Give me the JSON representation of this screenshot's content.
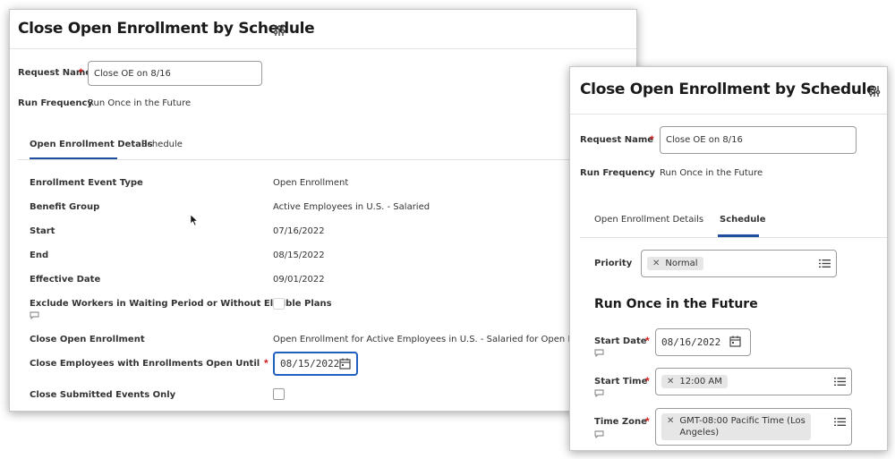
{
  "left": {
    "title": "Close Open Enrollment by Schedule",
    "request_name_label": "Request Name",
    "request_name_value": "Close OE on 8/16",
    "run_frequency_label": "Run Frequency",
    "run_frequency_value": "Run Once in the Future",
    "tabs": [
      {
        "label": "Open Enrollment Details",
        "active": true
      },
      {
        "label": "Schedule",
        "active": false
      }
    ],
    "fields": [
      {
        "label": "Enrollment Event Type",
        "value": "Open Enrollment"
      },
      {
        "label": "Benefit Group",
        "value": "Active Employees in U.S. - Salaried"
      },
      {
        "label": "Start",
        "value": "07/16/2022"
      },
      {
        "label": "End",
        "value": "08/15/2022"
      },
      {
        "label": "Effective Date",
        "value": "09/01/2022"
      }
    ],
    "exclude_label": "Exclude Workers in Waiting Period or Without Eligible Plans",
    "close_oe_label": "Close Open Enrollment",
    "close_oe_value": "Open Enrollment for Active Employees in U.S. - Salaried for Open Enrollment o",
    "close_employees_label": "Close Employees with Enrollments Open Until",
    "close_employees_date": "08/15/2022",
    "close_submitted_label": "Close Submitted Events Only"
  },
  "right": {
    "title": "Close Open Enrollment by Schedule",
    "request_name_label": "Request Name",
    "request_name_value": "Close OE on 8/16",
    "run_frequency_label": "Run Frequency",
    "run_frequency_value": "Run Once in the Future",
    "tabs": [
      {
        "label": "Open Enrollment Details",
        "active": false
      },
      {
        "label": "Schedule",
        "active": true
      }
    ],
    "priority_label": "Priority",
    "priority_value": "Normal",
    "section_heading": "Run Once in the Future",
    "start_date_label": "Start Date",
    "start_date_value": "08/16/2022",
    "start_time_label": "Start Time",
    "start_time_value": "12:00 AM",
    "time_zone_label": "Time Zone",
    "time_zone_line1": "GMT-08:00 Pacific Time (Los",
    "time_zone_line2": "Angeles)"
  },
  "colors": {
    "accent": "#1f4e9e",
    "required": "#d21f1f",
    "focus_border": "#1f5fbf",
    "pill_bg": "#e6e6e6"
  },
  "icons": [
    "related-actions-icon",
    "calendar-icon",
    "comment-icon",
    "list-icon",
    "remove-x-icon",
    "mouse-pointer-icon"
  ]
}
